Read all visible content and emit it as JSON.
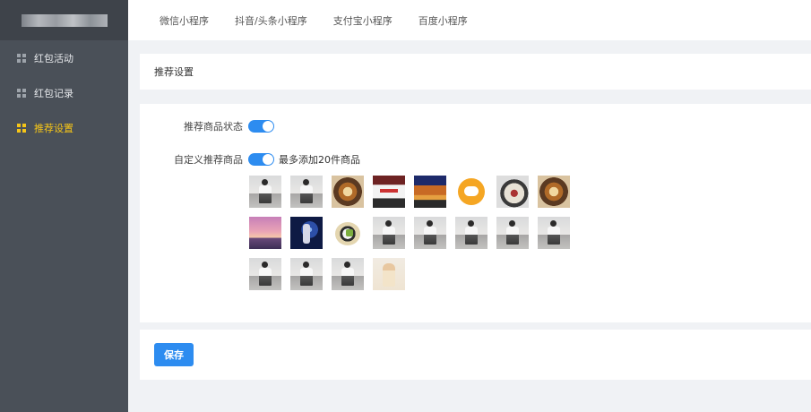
{
  "sidebar": {
    "items": [
      {
        "label": "红包活动",
        "icon": "grid-icon",
        "active": false
      },
      {
        "label": "红包记录",
        "icon": "grid-icon",
        "active": false
      },
      {
        "label": "推荐设置",
        "icon": "grid-icon",
        "active": true
      }
    ],
    "active_color": "#f5c518"
  },
  "tabs": [
    "微信小程序",
    "抖音/头条小程序",
    "支付宝小程序",
    "百度小程序"
  ],
  "panel": {
    "title": "推荐设置"
  },
  "form": {
    "status_label": "推荐商品状态",
    "status_on": true,
    "custom_label": "自定义推荐商品",
    "custom_on": true,
    "custom_hint": "最多添加20件商品",
    "thumbnails": [
      "person-photo",
      "person-photo",
      "pastry-photo",
      "product-card",
      "food-photo",
      "chat-icon-image",
      "bowl-photo",
      "pastry-photo",
      "sunset-photo",
      "blue-poster",
      "vegetable-plate",
      "person-photo",
      "person-photo",
      "person-photo",
      "person-photo",
      "person-photo",
      "person-photo",
      "person-photo",
      "person-photo",
      "dress-photo"
    ]
  },
  "actions": {
    "save_label": "保存"
  },
  "colors": {
    "sidebar_bg": "#4a5058",
    "primary": "#2d8cf0",
    "page_bg": "#f0f2f5"
  }
}
